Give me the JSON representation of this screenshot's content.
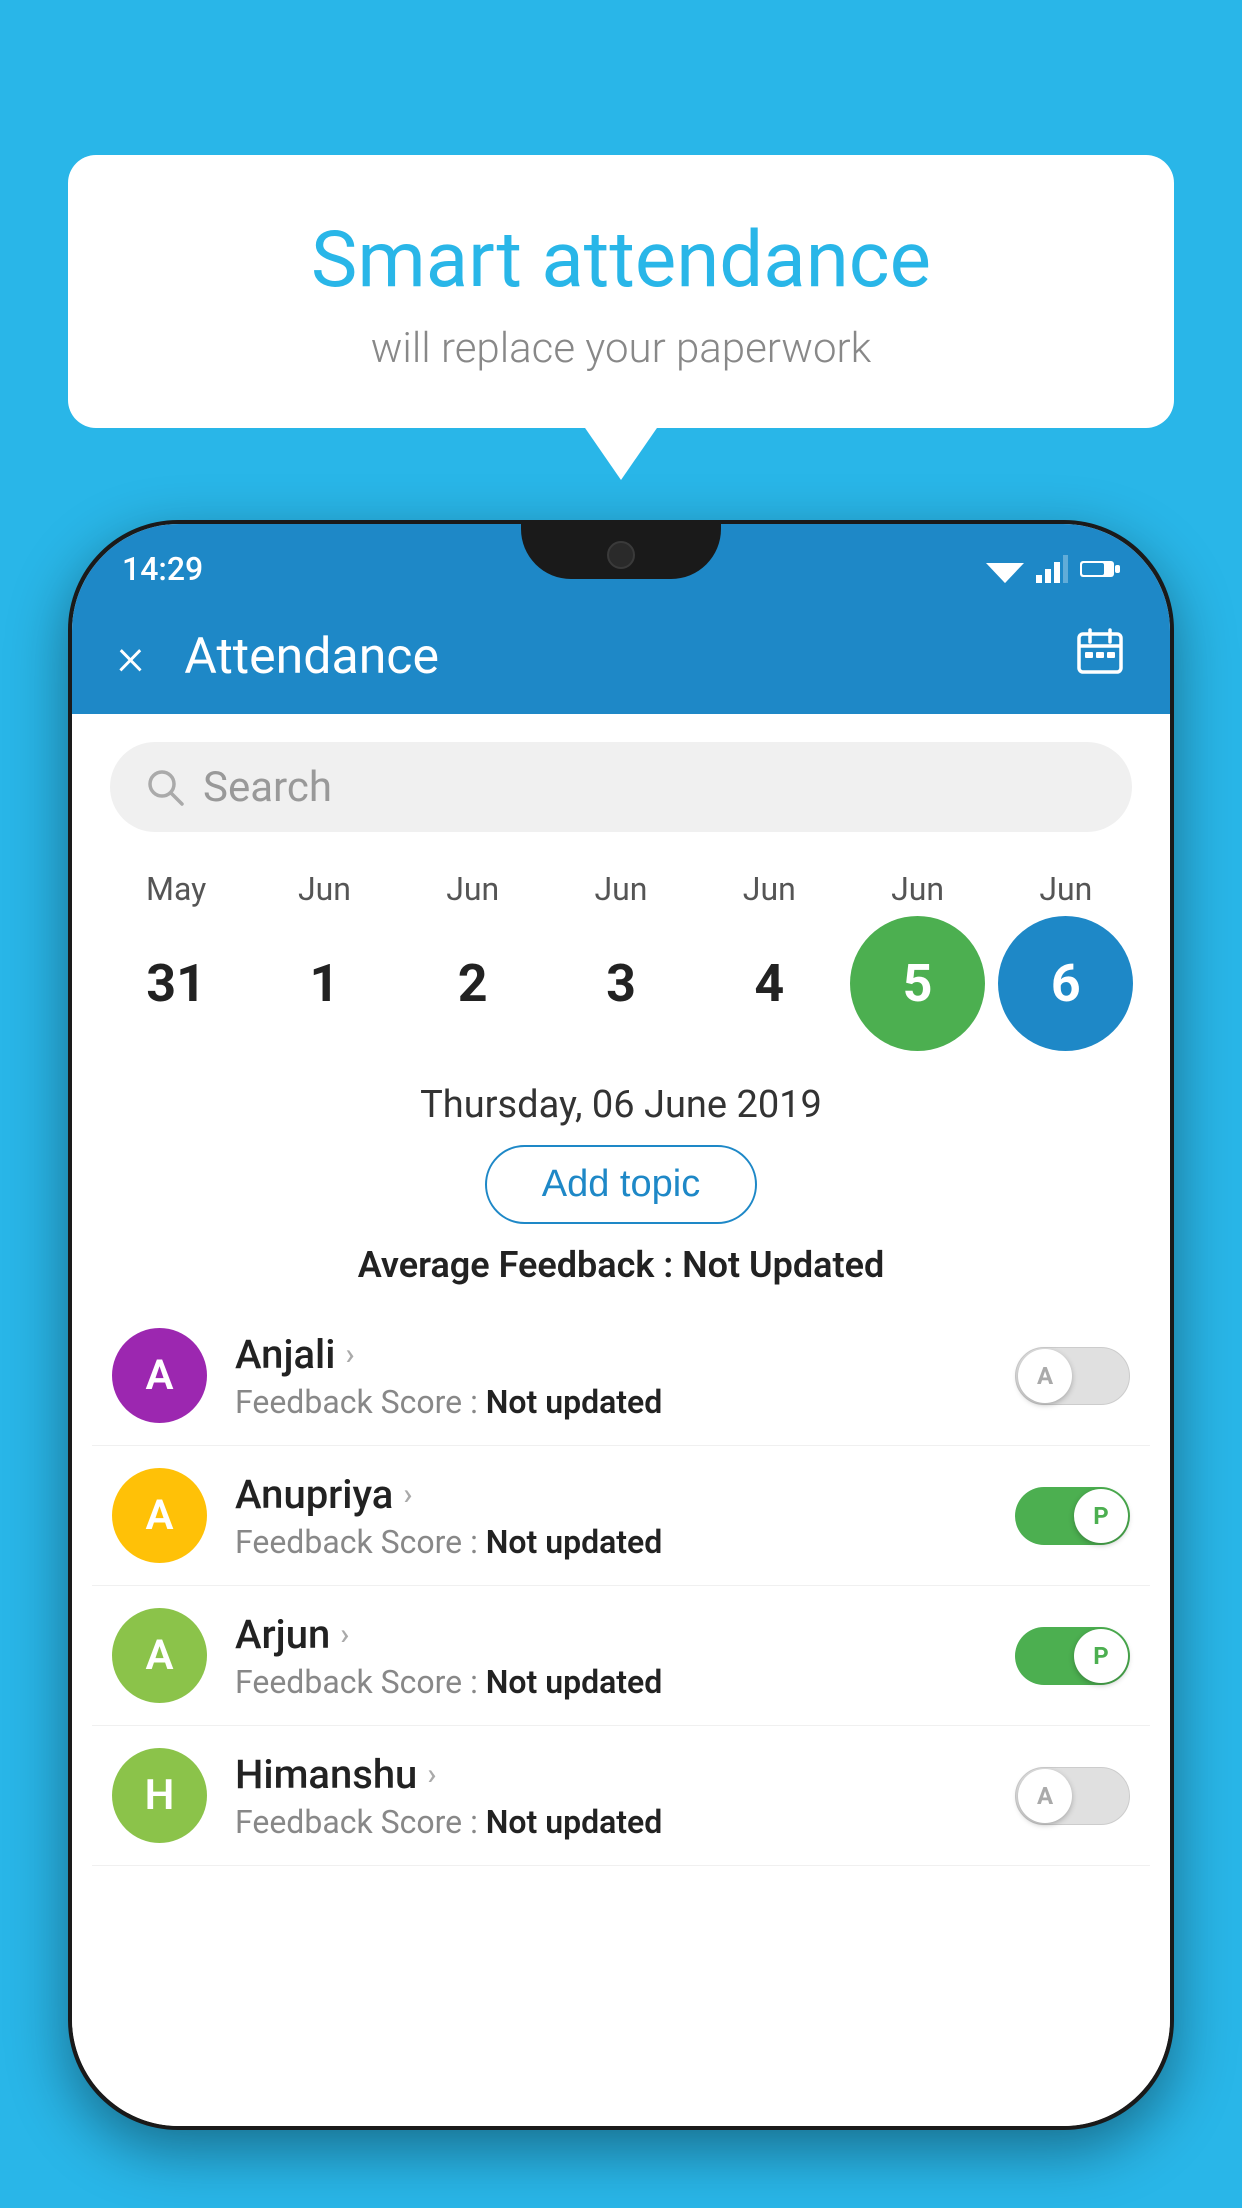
{
  "background_color": "#29B6E8",
  "speech_bubble": {
    "title": "Smart attendance",
    "subtitle": "will replace your paperwork"
  },
  "status_bar": {
    "time": "14:29"
  },
  "app_bar": {
    "title": "Attendance",
    "close_label": "×"
  },
  "search": {
    "placeholder": "Search"
  },
  "calendar": {
    "months": [
      "May",
      "Jun",
      "Jun",
      "Jun",
      "Jun",
      "Jun",
      "Jun"
    ],
    "dates": [
      "31",
      "1",
      "2",
      "3",
      "4",
      "5",
      "6"
    ],
    "states": [
      "normal",
      "normal",
      "normal",
      "normal",
      "normal",
      "today",
      "selected"
    ]
  },
  "selected_date": {
    "label": "Thursday, 06 June 2019"
  },
  "add_topic_button": "Add topic",
  "avg_feedback": {
    "label": "Average Feedback : ",
    "value": "Not Updated"
  },
  "students": [
    {
      "name": "Anjali",
      "initial": "A",
      "avatar_color": "#9C27B0",
      "feedback_label": "Feedback Score : ",
      "feedback_value": "Not updated",
      "attendance": "absent",
      "toggle_label": "A"
    },
    {
      "name": "Anupriya",
      "initial": "A",
      "avatar_color": "#FFC107",
      "feedback_label": "Feedback Score : ",
      "feedback_value": "Not updated",
      "attendance": "present",
      "toggle_label": "P"
    },
    {
      "name": "Arjun",
      "initial": "A",
      "avatar_color": "#8BC34A",
      "feedback_label": "Feedback Score : ",
      "feedback_value": "Not updated",
      "attendance": "present",
      "toggle_label": "P"
    },
    {
      "name": "Himanshu",
      "initial": "H",
      "avatar_color": "#8BC34A",
      "feedback_label": "Feedback Score : ",
      "feedback_value": "Not updated",
      "attendance": "absent",
      "toggle_label": "A"
    }
  ]
}
